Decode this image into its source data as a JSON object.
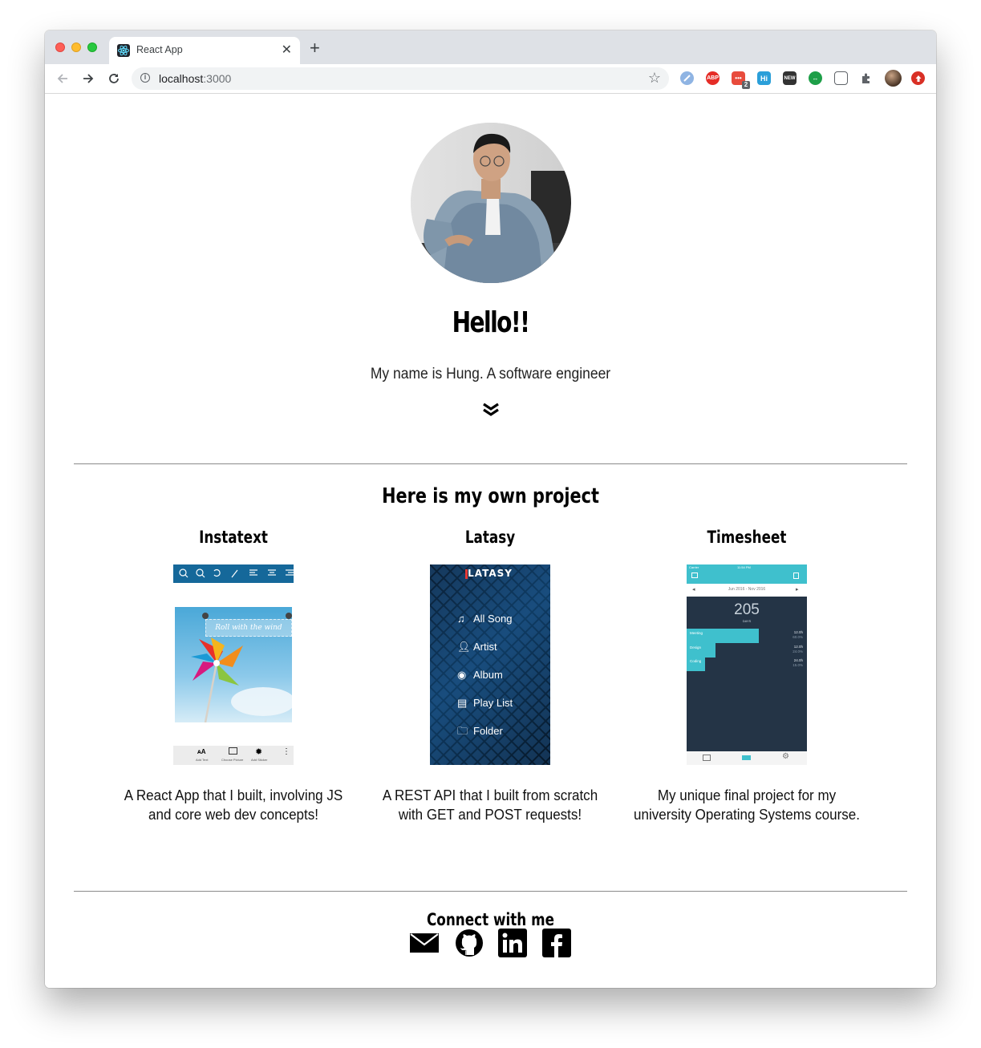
{
  "browser": {
    "tab_title": "React App",
    "url_host": "localhost",
    "url_port": ":3000",
    "extensions": [
      "reader-icon",
      "adblock-plus-icon",
      "todo-extension-icon",
      "hi-icon",
      "new-extension-icon",
      "share-extension-icon",
      "capture-icon",
      "extensions-puzzle-icon",
      "profile-avatar",
      "update-icon"
    ],
    "extension_labels": {
      "abp": "ABP",
      "badge": "2",
      "hi": "Hi",
      "new": "NEW"
    }
  },
  "hero": {
    "greeting": "Hello!!",
    "intro": "My name is Hung. A software engineer"
  },
  "projects_section": {
    "title": "Here is my own project",
    "items": [
      {
        "name": "Instatext",
        "description": "A React App that I built, involving JS and core web dev concepts!",
        "screenshot": {
          "overlay_text": "Roll with the wind",
          "bottom_labels": [
            "Add Text",
            "Choose Picture",
            "Add Sticker"
          ]
        }
      },
      {
        "name": "Latasy",
        "description": "A REST API that I built from scratch with GET and POST requests!",
        "screenshot": {
          "logo": "LATASY",
          "menu": [
            "All Song",
            "Artist",
            "Album",
            "Play List",
            "Folder"
          ]
        }
      },
      {
        "name": "Timesheet",
        "description": "My unique final project for my university Operating Systems course.",
        "screenshot": {
          "status_left": "Carrier",
          "status_time": "11:54 PM",
          "date_range": "Jun 2016 - Nov 2016",
          "total": "205",
          "total_unit": "DAYS",
          "bars": [
            {
              "label": "Meeting",
              "hours": "12.0h",
              "percent": "60.0%",
              "fraction": 0.6
            },
            {
              "label": "Design",
              "hours": "12.0h",
              "percent": "24.0%",
              "fraction": 0.24
            },
            {
              "label": "Coding",
              "hours": "24.0h",
              "percent": "15.0%",
              "fraction": 0.15
            }
          ]
        }
      }
    ]
  },
  "connect": {
    "title": "Connect with me",
    "links": [
      "email-icon",
      "github-icon",
      "linkedin-icon",
      "facebook-icon"
    ]
  },
  "colors": {
    "tabbar": "#dee1e6",
    "instatext_toolbar": "#15689a",
    "latasy_bg": "#0c2c4a",
    "timesheet_header": "#3fc0cd",
    "timesheet_body": "#243446"
  }
}
